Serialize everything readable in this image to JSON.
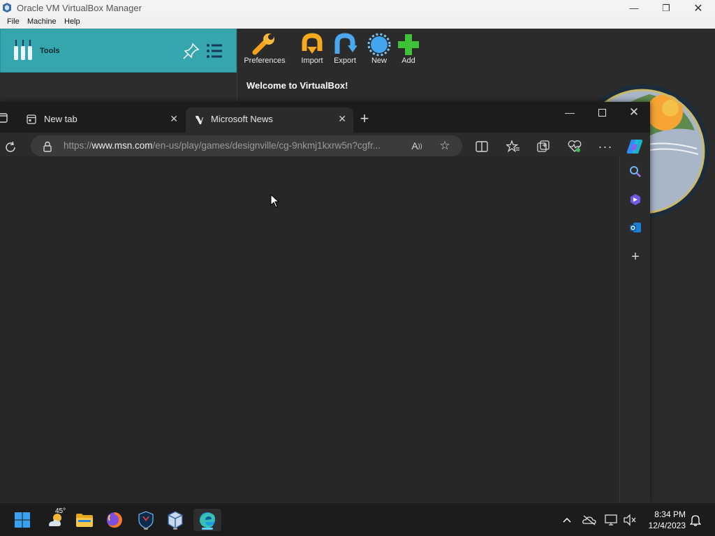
{
  "vbox": {
    "title": "Oracle VM VirtualBox Manager",
    "menu": [
      "File",
      "Machine",
      "Help"
    ],
    "tools_label": "Tools",
    "toolbar": [
      {
        "label": "Preferences",
        "icon": "preferences-icon"
      },
      {
        "label": "Import",
        "icon": "import-icon"
      },
      {
        "label": "Export",
        "icon": "export-icon"
      },
      {
        "label": "New",
        "icon": "new-icon"
      },
      {
        "label": "Add",
        "icon": "add-icon"
      }
    ],
    "welcome": "Welcome to VirtualBox!"
  },
  "edge": {
    "tabs": [
      {
        "label": "New tab",
        "icon": "new-tab-icon"
      },
      {
        "label": "Microsoft News",
        "icon": "msn-icon"
      }
    ],
    "url_prefix": "https://",
    "url_domain": "www.msn.com",
    "url_path": "/en-us/play/games/designville/cg-9nkmj1kxrw5n?cgfr..."
  },
  "taskbar": {
    "weather_temp": "45°",
    "time": "8:34 PM",
    "date": "12/4/2023"
  },
  "colors": {
    "tools_bg": "#36a6ae",
    "edge_accent": "#60cdff"
  }
}
